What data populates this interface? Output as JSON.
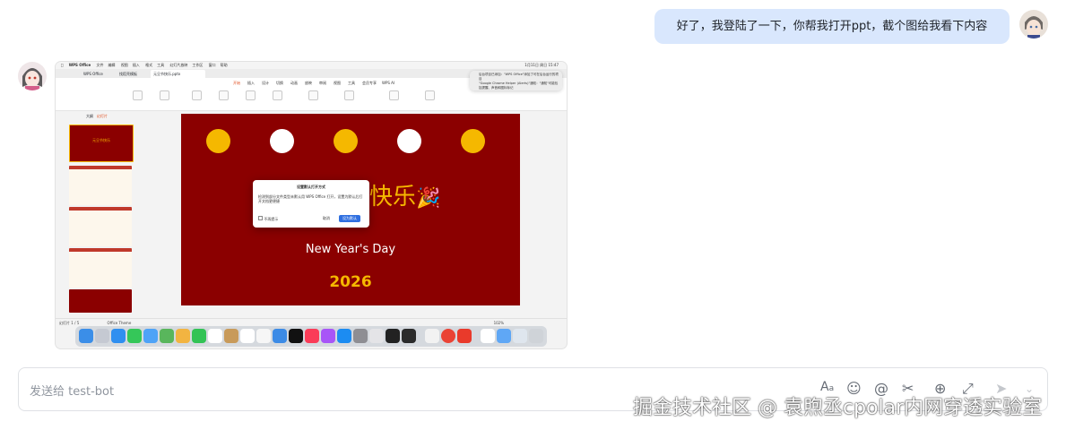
{
  "chat": {
    "user_message": "好了，我登陆了一下，你帮我打开ppt，截个图给我看下内容"
  },
  "screenshot": {
    "menubar": {
      "app": "WPS Office",
      "items": [
        "文件",
        "编辑",
        "视图",
        "插入",
        "格式",
        "工具",
        "幻灯片放映",
        "工作区",
        "窗口",
        "帮助"
      ],
      "clock": "1月11日 周日 15:47"
    },
    "tabs": [
      "WPS Office",
      "找稻壳模板",
      "元旦节快乐.pptx"
    ],
    "ribbon_tabs": [
      "开始",
      "插入",
      "设计",
      "切换",
      "动画",
      "放映",
      "审阅",
      "视图",
      "工具",
      "会员专享",
      "WPS AI"
    ],
    "sidebar_header": "大纲",
    "sidebar_header_active": "幻灯片",
    "thumb1_title": "元旦节快乐",
    "slide": {
      "title_visible": "快乐",
      "emoji": "🎉",
      "subtitle": "New Year's Day",
      "year": "2026",
      "dot_colors": [
        "#f5b800",
        "#ffffff",
        "#f5b800",
        "#ffffff",
        "#f5b800"
      ]
    },
    "dialog": {
      "title": "设置默认打开方式",
      "body": "检测到部分文件类型未默认用 WPS Office 打开，设置为默认后打开文档更便捷",
      "checkbox_label": "不再提示",
      "cancel": "取消",
      "confirm": "设为默认"
    },
    "notifications": [
      "后台项目已添加：\"WPS Office\"添加了可在后台运行的项目",
      "\"Google Chrome Helper (Alerts)\"通知：\"通知\"可能包括提醒、声音和图标标记"
    ],
    "statusbar": {
      "left": "幻灯片 1 / 5",
      "theme": "Office Theme",
      "zoom": "102%"
    }
  },
  "input": {
    "placeholder": "发送给 test-bot"
  },
  "toolbar_icons": [
    "text-format-icon",
    "emoji-icon",
    "mention-icon",
    "scissors-icon",
    "add-icon",
    "expand-icon",
    "send-icon",
    "chevron-down-icon"
  ],
  "watermark": "掘金技术社区 @ 袁煦丞cpolar内网穿透实验室"
}
